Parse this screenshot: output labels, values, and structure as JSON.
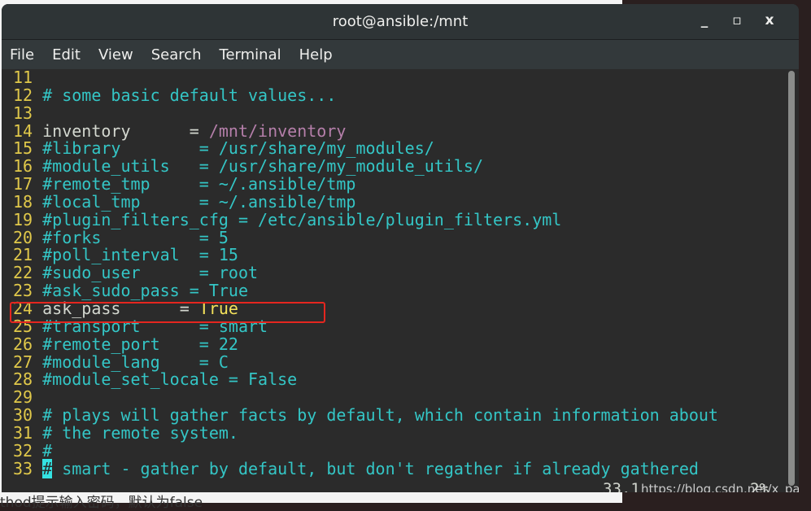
{
  "window": {
    "title": "root@ansible:/mnt",
    "minimize": "_",
    "maximize": "▫",
    "close": "x"
  },
  "menu": [
    "File",
    "Edit",
    "View",
    "Search",
    "Terminal",
    "Help"
  ],
  "colors": {
    "line_number": "#e0c84a",
    "comment": "#34c6c6",
    "path": "#b57faa",
    "value": "#f4e25a",
    "highlight_box": "#e5261f"
  },
  "lines": [
    {
      "n": "11",
      "segs": []
    },
    {
      "n": "12",
      "segs": [
        {
          "t": "# some basic default values...",
          "k": "c"
        }
      ]
    },
    {
      "n": "13",
      "segs": []
    },
    {
      "n": "14",
      "segs": [
        {
          "t": "inventory      = ",
          "k": ""
        },
        {
          "t": "/mnt/inventory",
          "k": "p"
        }
      ]
    },
    {
      "n": "15",
      "segs": [
        {
          "t": "#library        = /usr/share/my_modules/",
          "k": "c"
        }
      ]
    },
    {
      "n": "16",
      "segs": [
        {
          "t": "#module_utils   = /usr/share/my_module_utils/",
          "k": "c"
        }
      ]
    },
    {
      "n": "17",
      "segs": [
        {
          "t": "#remote_tmp     = ~/.ansible/tmp",
          "k": "c"
        }
      ]
    },
    {
      "n": "18",
      "segs": [
        {
          "t": "#local_tmp      = ~/.ansible/tmp",
          "k": "c"
        }
      ]
    },
    {
      "n": "19",
      "segs": [
        {
          "t": "#plugin_filters_cfg = /etc/ansible/plugin_filters.yml",
          "k": "c"
        }
      ]
    },
    {
      "n": "20",
      "segs": [
        {
          "t": "#forks          = 5",
          "k": "c"
        }
      ]
    },
    {
      "n": "21",
      "segs": [
        {
          "t": "#poll_interval  = 15",
          "k": "c"
        }
      ]
    },
    {
      "n": "22",
      "segs": [
        {
          "t": "#sudo_user      = root",
          "k": "c"
        }
      ]
    },
    {
      "n": "23",
      "segs": [
        {
          "t": "#ask_sudo_pass = True",
          "k": "c"
        }
      ]
    },
    {
      "n": "24",
      "segs": [
        {
          "t": "ask_pass      = ",
          "k": ""
        },
        {
          "t": "True",
          "k": "y"
        }
      ]
    },
    {
      "n": "25",
      "segs": [
        {
          "t": "#transport      = smart",
          "k": "c"
        }
      ]
    },
    {
      "n": "26",
      "segs": [
        {
          "t": "#remote_port    = 22",
          "k": "c"
        }
      ]
    },
    {
      "n": "27",
      "segs": [
        {
          "t": "#module_lang    = C",
          "k": "c"
        }
      ]
    },
    {
      "n": "28",
      "segs": [
        {
          "t": "#module_set_locale = False",
          "k": "c"
        }
      ]
    },
    {
      "n": "29",
      "segs": []
    },
    {
      "n": "30",
      "segs": [
        {
          "t": "# plays will gather facts by default, which contain information about",
          "k": "c"
        }
      ]
    },
    {
      "n": "31",
      "segs": [
        {
          "t": "# the remote system.",
          "k": "c"
        }
      ]
    },
    {
      "n": "32",
      "segs": [
        {
          "t": "#",
          "k": "c"
        }
      ]
    },
    {
      "n": "33",
      "segs": [
        {
          "t": "#",
          "k": "cur"
        },
        {
          "t": " smart - gather by default, but don't regather if already gathered",
          "k": "c"
        }
      ]
    }
  ],
  "status": {
    "position": "33,1",
    "percent": "2%"
  },
  "watermark": "https://blog.csdn.net/x_pang",
  "background_text": "thod提示输入密码，默认为false"
}
